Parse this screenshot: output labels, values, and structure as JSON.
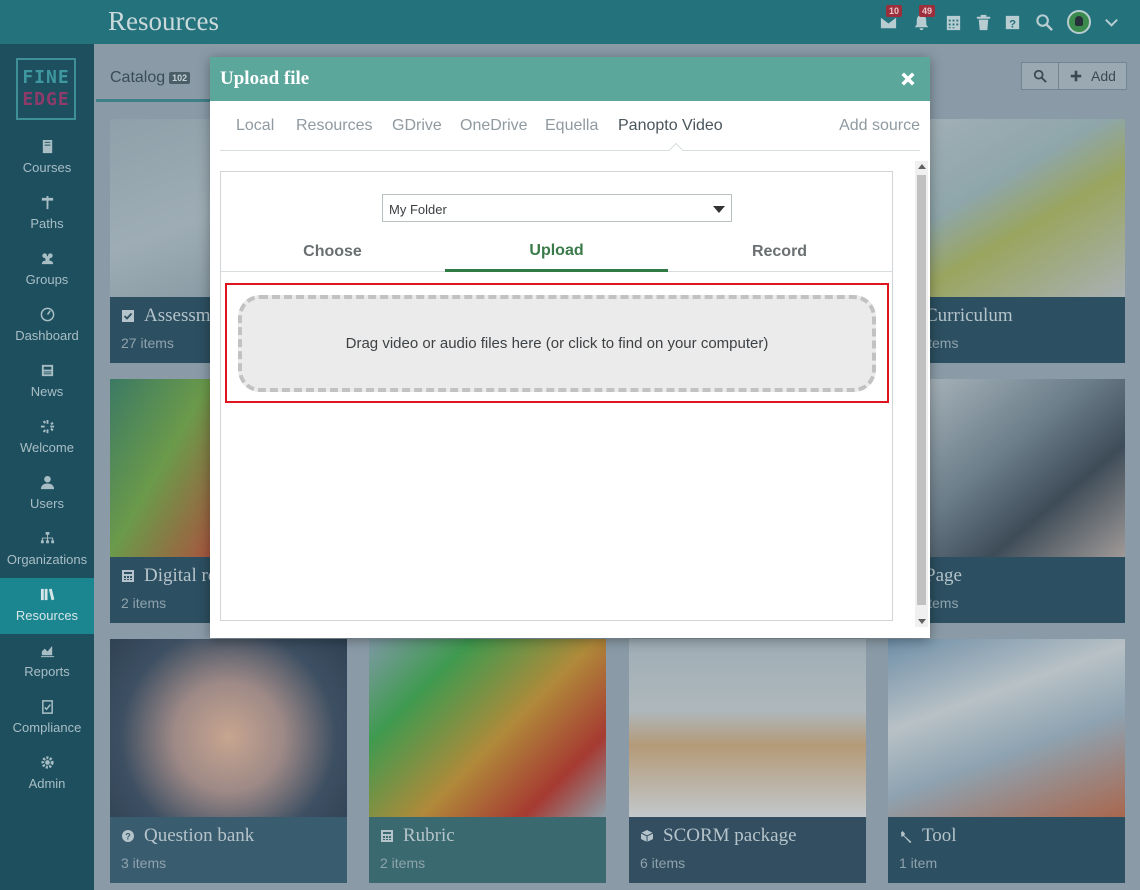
{
  "header": {
    "title": "Resources",
    "mail_count": "10",
    "notifications_count": "49",
    "icons": [
      "mail-icon",
      "bell-icon",
      "calendar-icon",
      "trash-icon",
      "help-icon",
      "search-icon",
      "avatar",
      "chevron-down-icon"
    ]
  },
  "sidebar": {
    "logo_line1": "FINE",
    "logo_line2": "EDGE",
    "items": [
      {
        "label": "Courses",
        "icon": "book-icon"
      },
      {
        "label": "Paths",
        "icon": "signpost-icon"
      },
      {
        "label": "Groups",
        "icon": "groups-icon"
      },
      {
        "label": "Dashboard",
        "icon": "dashboard-icon"
      },
      {
        "label": "News",
        "icon": "newspaper-icon"
      },
      {
        "label": "Welcome",
        "icon": "sparkle-icon"
      },
      {
        "label": "Users",
        "icon": "user-icon"
      },
      {
        "label": "Organizations",
        "icon": "org-chart-icon"
      },
      {
        "label": "Resources",
        "icon": "library-icon",
        "active": true
      },
      {
        "label": "Reports",
        "icon": "chart-icon"
      },
      {
        "label": "Compliance",
        "icon": "clipboard-check-icon"
      },
      {
        "label": "Admin",
        "icon": "gear-icon"
      }
    ]
  },
  "catalog": {
    "tab_label": "Catalog",
    "tab_count": "102",
    "add_label": "Add",
    "cards": [
      {
        "title": "Assessment",
        "count": "27 items",
        "icon": "check-square-icon"
      },
      {
        "title": "Curriculum",
        "count": "items"
      },
      {
        "title": "Digital resource",
        "count": "2 items",
        "icon": "calculator-icon"
      },
      {
        "title": "Page",
        "count": "items"
      },
      {
        "title": "Question bank",
        "count": "3 items",
        "icon": "question-circle-icon"
      },
      {
        "title": "Rubric",
        "count": "2 items",
        "icon": "calculator-icon"
      },
      {
        "title": "SCORM package",
        "count": "6 items",
        "icon": "cube-icon"
      },
      {
        "title": "Tool",
        "count": "1 item",
        "icon": "wrench-icon"
      }
    ]
  },
  "modal": {
    "title": "Upload file",
    "source_tabs": [
      "Local",
      "Resources",
      "GDrive",
      "OneDrive",
      "Equella",
      "Panopto Video"
    ],
    "active_source": "Panopto Video",
    "add_source": "Add source",
    "folder_select": "My Folder",
    "upload_tabs": [
      "Choose",
      "Upload",
      "Record"
    ],
    "active_upload_tab": "Upload",
    "dropzone_text": "Drag video or audio files here (or click to find on your computer)"
  },
  "colors": {
    "header_bg": "#24727c",
    "sidebar_bg": "#1d4f5f",
    "sidebar_active": "#1b8590",
    "modal_header": "#5ca79b",
    "upload_tab_active": "#2f7a45",
    "highlight": "#e0141f"
  }
}
